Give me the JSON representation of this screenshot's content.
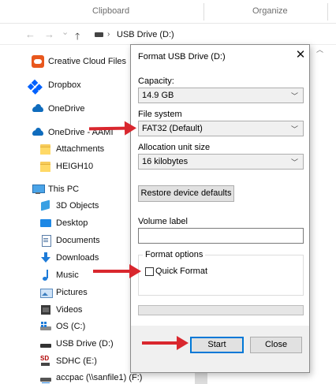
{
  "ribbon": {
    "groups": [
      "Clipboard",
      "Organize"
    ]
  },
  "address_bar": {
    "back_icon": "arrow-left-icon",
    "forward_icon": "arrow-right-icon",
    "up_icon": "arrow-up-icon",
    "path": "USB Drive (D:)"
  },
  "nav_pane": {
    "items": [
      {
        "label": "Creative Cloud Files",
        "icon": "creative-cloud-icon"
      },
      {
        "label": "Dropbox",
        "icon": "dropbox-icon"
      },
      {
        "label": "OneDrive",
        "icon": "cloud-icon"
      },
      {
        "label": "OneDrive - AAMI",
        "icon": "cloud-icon"
      },
      {
        "label": "Attachments",
        "icon": "folder-icon"
      },
      {
        "label": "HEIGH10",
        "icon": "folder-icon"
      },
      {
        "label": "This PC",
        "icon": "computer-icon"
      },
      {
        "label": "3D Objects",
        "icon": "3d-objects-icon"
      },
      {
        "label": "Desktop",
        "icon": "desktop-icon"
      },
      {
        "label": "Documents",
        "icon": "documents-icon"
      },
      {
        "label": "Downloads",
        "icon": "download-icon"
      },
      {
        "label": "Music",
        "icon": "music-icon"
      },
      {
        "label": "Pictures",
        "icon": "pictures-icon"
      },
      {
        "label": "Videos",
        "icon": "videos-icon"
      },
      {
        "label": "OS (C:)",
        "icon": "os-drive-icon"
      },
      {
        "label": "USB Drive (D:)",
        "icon": "usb-drive-icon"
      },
      {
        "label": "SDHC (E:)",
        "icon": "sd-card-icon"
      },
      {
        "label": "accpac (\\\\sanfile1) (F:)",
        "icon": "network-drive-icon"
      }
    ]
  },
  "dialog": {
    "title": "Format USB Drive (D:)",
    "close_label": "✕",
    "capacity_label": "Capacity:",
    "capacity_value": "14.9 GB",
    "file_system_label": "File system",
    "file_system_value": "FAT32 (Default)",
    "allocation_label": "Allocation unit size",
    "allocation_value": "16 kilobytes",
    "restore_button": "Restore device defaults",
    "volume_label": "Volume label",
    "volume_value": "",
    "format_options_label": "Format options",
    "quick_format_label": "Quick Format",
    "quick_format_checked": false,
    "progress": 0,
    "start_button": "Start",
    "close_button": "Close"
  },
  "annotations": {
    "arrow_color": "#d9272e"
  },
  "colors": {
    "accent": "#0078d7"
  }
}
